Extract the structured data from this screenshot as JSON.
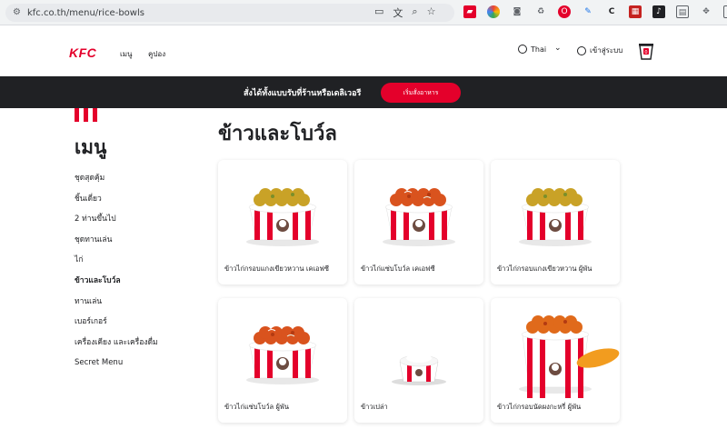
{
  "browser": {
    "url": "kfc.co.th/menu/rice-bowls",
    "ext_labels": [
      "C"
    ]
  },
  "header": {
    "logo": "KFC",
    "nav": [
      "เมนู",
      "คูปอง"
    ],
    "language": "Thai",
    "login": "เข้าสู่ระบบ"
  },
  "banner": {
    "text": "สั่งได้ทั้งแบบรับที่ร้านหรือเดลิเวอรี",
    "button": "เริ่มสั่งอาหาร"
  },
  "sidebar": {
    "title": "เมนู",
    "items": [
      {
        "label": "ชุดสุดคุ้ม"
      },
      {
        "label": "ชิ้นเดี่ยว"
      },
      {
        "label": "2 ท่านขึ้นไป"
      },
      {
        "label": "ชุดทานเล่น"
      },
      {
        "label": "ไก่"
      },
      {
        "label": "ข้าวและโบว์ล",
        "active": true
      },
      {
        "label": "ทานเล่น"
      },
      {
        "label": "เบอร์เกอร์"
      },
      {
        "label": "เครื่องเคียง และเครื่องดื่ม"
      },
      {
        "label": "Secret Menu"
      }
    ]
  },
  "main": {
    "title": "ข้าวและโบว์ล",
    "products": [
      {
        "name": "ข้าวไก่กรอบแกงเขียวหวาน เคเอฟซี",
        "topping": "green"
      },
      {
        "name": "ข้าวไก่แซ่บโบว์ล เคเอฟซี",
        "topping": "spicy"
      },
      {
        "name": "ข้าวไก่กรอบแกงเขียวหวาน ผู้พัน",
        "topping": "green"
      },
      {
        "name": "ข้าวไก่แซ่บโบว์ล ผู้พัน",
        "topping": "spicy"
      },
      {
        "name": "ข้าวเปล่า",
        "topping": "rice"
      },
      {
        "name": "ข้าวไก่กรอบนัดผงกะหรี่ ผู้พัน",
        "topping": "curry"
      }
    ]
  },
  "colors": {
    "brand_red": "#e4002b",
    "banner_bg": "#202124"
  }
}
